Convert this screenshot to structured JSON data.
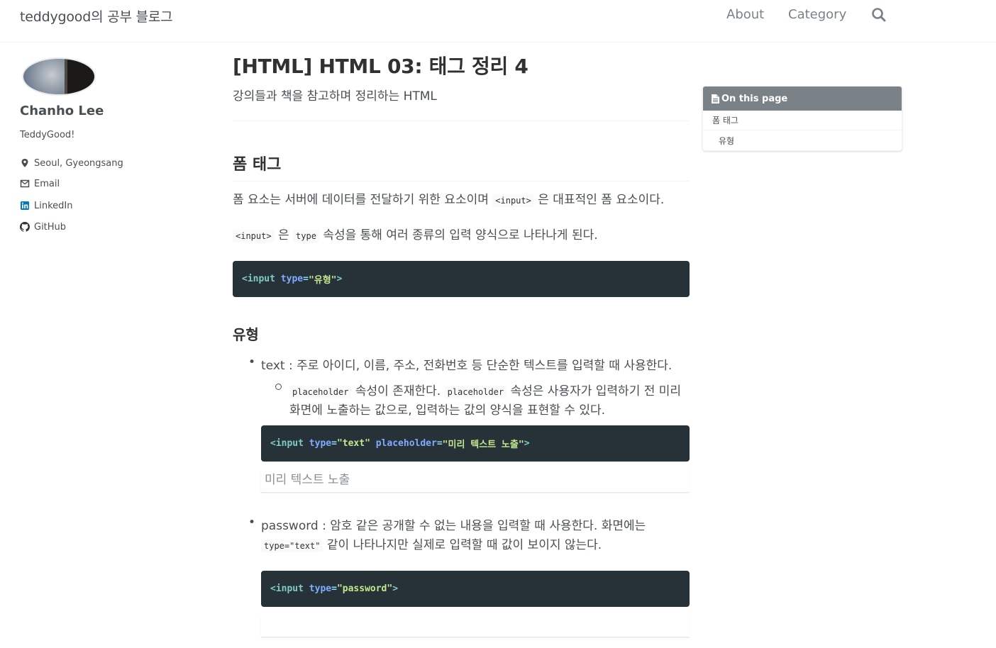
{
  "masthead": {
    "site_title": "teddygood의 공부 블로그",
    "nav": [
      "About",
      "Category"
    ],
    "search_icon": "search-icon"
  },
  "author": {
    "name": "Chanho Lee",
    "bio": "TeddyGood!",
    "links": [
      {
        "icon": "location-pin-icon",
        "label": "Seoul, Gyeongsang"
      },
      {
        "icon": "envelope-icon",
        "label": "Email"
      },
      {
        "icon": "linkedin-icon",
        "label": "LinkedIn"
      },
      {
        "icon": "github-icon",
        "label": "GitHub"
      }
    ]
  },
  "article": {
    "title": "[HTML] HTML 03: 태그 정리 4",
    "subtitle": "강의들과 책을 참고하며 정리하는 HTML",
    "section_heading": "폼 태그",
    "p1": {
      "before": "폼 요소는 서버에 데이터를 전달하기 위한 요소이며 ",
      "code": "<input>",
      "after": " 은 대표적인 폼 요소이다."
    },
    "p2": {
      "code1": "<input>",
      "mid1": " 은 ",
      "code2": "type",
      "after": " 속성을 통해 여러 종류의 입력 양식으로 나타나게 된다."
    },
    "code1": {
      "open": "<input",
      "attr": "type",
      "eq": "=",
      "val": "\"유형\"",
      "close": ">"
    },
    "subsection_heading": "유형",
    "bullet_text": "text : 주로 아이디, 이름, 주소, 전화번호 등 단순한 텍스트를 입력할 때 사용한다.",
    "sub_bullet": {
      "code1": "placeholder",
      "mid1": " 속성이 존재한다. ",
      "code2": "placeholder",
      "line1_end": " 속성은 사용자가 입력하기 전 미리",
      "line2": "화면에 노출하는 값으로, 입력하는 값의 양식을 표현할 수 있다."
    },
    "code2": {
      "open": "<input",
      "attr1": "type",
      "eq": "=",
      "val1": "\"text\"",
      "attr2": "placeholder",
      "val2": "\"미리 텍스트 노출\"",
      "close": ">"
    },
    "demo_placeholder": "미리 텍스트 노출",
    "bullet_password": {
      "line1": "password : 암호 같은 공개할 수 없는 내용을 입력할 때 사용한다. 화면에는",
      "code": "type=\"text\"",
      "line2_end": " 같이 나타나지만 실제로 입력할 때 값이 보이지 않는다."
    },
    "code3": {
      "open": "<input",
      "attr": "type",
      "eq": "=",
      "val": "\"password\"",
      "close": ">"
    }
  },
  "toc": {
    "header": "On this page",
    "items": [
      "폼 태그",
      "유형"
    ]
  },
  "colors": {
    "code_bg": "#263238",
    "toc_header_bg": "#7a8288",
    "text": "#494e52"
  }
}
